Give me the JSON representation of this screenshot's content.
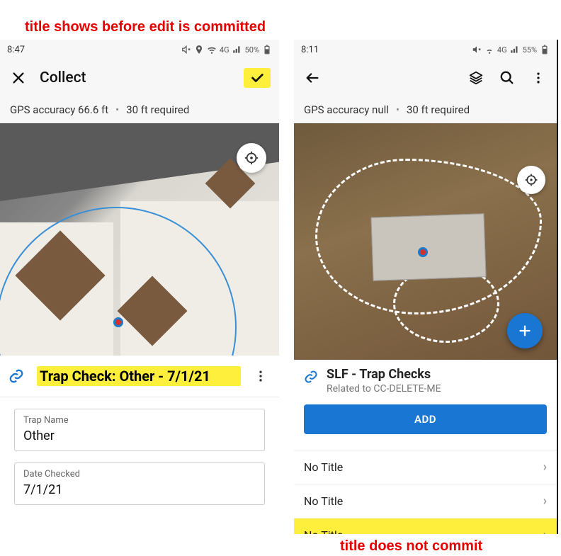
{
  "annotations": {
    "top": "title shows before edit is committed",
    "bottom": "title does not commit"
  },
  "left": {
    "status": {
      "time": "8:47",
      "battery": "50%",
      "network": "4G"
    },
    "appbar": {
      "title": "Collect"
    },
    "gps": {
      "accuracy": "GPS accuracy 66.6 ft",
      "required": "30 ft required"
    },
    "titlebar": {
      "title": "Trap Check: Other - 7/1/21"
    },
    "form": {
      "trap_name": {
        "label": "Trap Name",
        "value": "Other"
      },
      "date_checked": {
        "label": "Date Checked",
        "value": "7/1/21"
      }
    }
  },
  "right": {
    "status": {
      "time": "8:11",
      "battery": "55%",
      "network": "4G"
    },
    "gps": {
      "accuracy": "GPS accuracy null",
      "required": "30 ft required"
    },
    "panel": {
      "title": "SLF - Trap Checks",
      "subtitle": "Related to CC-DELETE-ME",
      "add_label": "ADD"
    },
    "list": {
      "items": [
        {
          "label": "No Title"
        },
        {
          "label": "No Title"
        },
        {
          "label": "No Title"
        }
      ]
    }
  },
  "colors": {
    "highlight": "#ffef3d",
    "primary": "#1976d2",
    "annotation": "#e60000"
  }
}
